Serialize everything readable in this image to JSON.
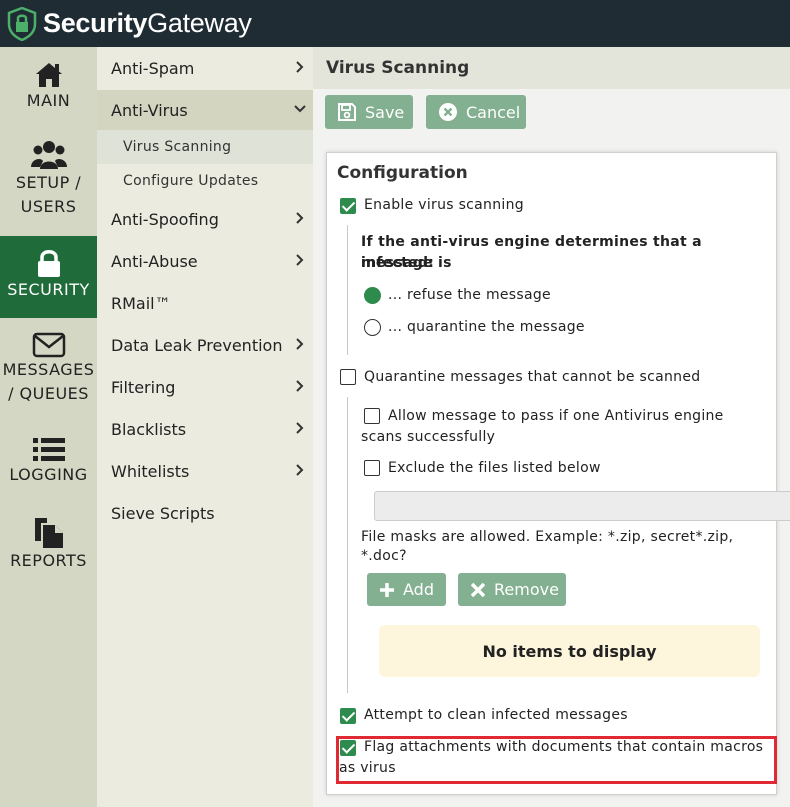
{
  "app": {
    "brand_bold": "Security",
    "brand_regular": "Gateway"
  },
  "nav": [
    {
      "label": "MAIN",
      "icon": "home-icon"
    },
    {
      "label_line1": "SETUP /",
      "label_line2": "USERS",
      "icon": "users-icon"
    },
    {
      "label": "SECURITY",
      "icon": "lock-icon",
      "active": true
    },
    {
      "label_line1": "MESSAGES",
      "label_line2": "/ QUEUES",
      "icon": "envelope-icon"
    },
    {
      "label": "LOGGING",
      "icon": "list-icon"
    },
    {
      "label": "REPORTS",
      "icon": "document-icon"
    }
  ],
  "submenu": {
    "anti_spam": "Anti-Spam",
    "anti_virus": "Anti-Virus",
    "virus_scanning": "Virus Scanning",
    "configure_updates": "Configure Updates",
    "anti_spoofing": "Anti-Spoofing",
    "anti_abuse": "Anti-Abuse",
    "rmail": "RMail™",
    "dlp": "Data Leak Prevention",
    "filtering": "Filtering",
    "blacklists": "Blacklists",
    "whitelists": "Whitelists",
    "sieve": "Sieve Scripts"
  },
  "page": {
    "title": "Virus Scanning",
    "save_label": "Save",
    "cancel_label": "Cancel"
  },
  "config": {
    "heading": "Configuration",
    "enable_label": "Enable virus scanning",
    "enable_checked": true,
    "infected_q_line1": "If the anti-virus engine determines that a message is",
    "infected_q_line2": "infected:",
    "refuse_label": "... refuse the message",
    "quarantine_label": "... quarantine the message",
    "selected_action": "refuse",
    "quarantine_unscanned_label": "Quarantine messages that cannot be scanned",
    "allow_pass_line1": "Allow message to pass if one Antivirus engine",
    "allow_pass_line2": "scans successfully",
    "exclude_label": "Exclude the files listed below",
    "file_input_value": "",
    "mask_hint_line1": "File masks are allowed. Example: *.zip, secret*.zip,",
    "mask_hint_line2": "*.doc?",
    "add_label": "Add",
    "remove_label": "Remove",
    "empty_text": "No items to display",
    "clean_label": "Attempt to clean infected messages",
    "clean_checked": true,
    "macros_line1": "Flag attachments with documents that contain macros",
    "macros_line2": "as virus",
    "macros_checked": true
  },
  "colors": {
    "header": "#1f2c33",
    "accent_green": "#2e8b4e",
    "active_nav": "#1f6b3a",
    "button": "#83b091",
    "highlight": "#e02a33"
  }
}
